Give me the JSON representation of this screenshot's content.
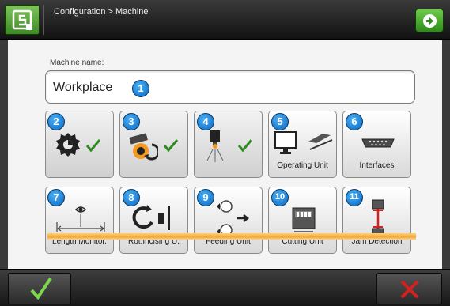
{
  "header": {
    "breadcrumb": "Configuration > Machine",
    "logo_icon": "s-logo-icon",
    "next_icon": "next-arrow-icon"
  },
  "machine_name": {
    "label": "Machine name:",
    "value": "Workplace",
    "badge": "1"
  },
  "tiles_row1": [
    {
      "badge": "2",
      "label": "",
      "icon": "saw-blade-icon",
      "status": "check-icon"
    },
    {
      "badge": "3",
      "label": "",
      "icon": "rotating-blade-icon",
      "status": "check-icon"
    },
    {
      "badge": "4",
      "label": "",
      "icon": "light-sensor-icon",
      "status": "check-icon"
    },
    {
      "badge": "5",
      "label": "Operating Unit",
      "icon": "monitor-keyboard-icon"
    },
    {
      "badge": "6",
      "label": "Interfaces",
      "icon": "serial-port-icon"
    }
  ],
  "tiles_row2": [
    {
      "badge": "7",
      "label": "Length Monitor.",
      "icon": "length-monitor-icon"
    },
    {
      "badge": "8",
      "label": "Rot.Incising U.",
      "icon": "rotary-incising-icon"
    },
    {
      "badge": "9",
      "label": "Feeding Unit",
      "icon": "feeding-rollers-icon"
    },
    {
      "badge": "10",
      "label": "Cutting Unit",
      "icon": "cutting-unit-icon"
    },
    {
      "badge": "11",
      "label": "Jam Detection",
      "icon": "jam-detection-icon"
    }
  ],
  "footer": {
    "ok_icon": "check-icon",
    "cancel_icon": "close-icon"
  },
  "colors": {
    "accent_green": "#3c8a24",
    "badge_blue": "#0a67c2",
    "belt_orange": "#f7a731",
    "cancel_red": "#d42020"
  }
}
